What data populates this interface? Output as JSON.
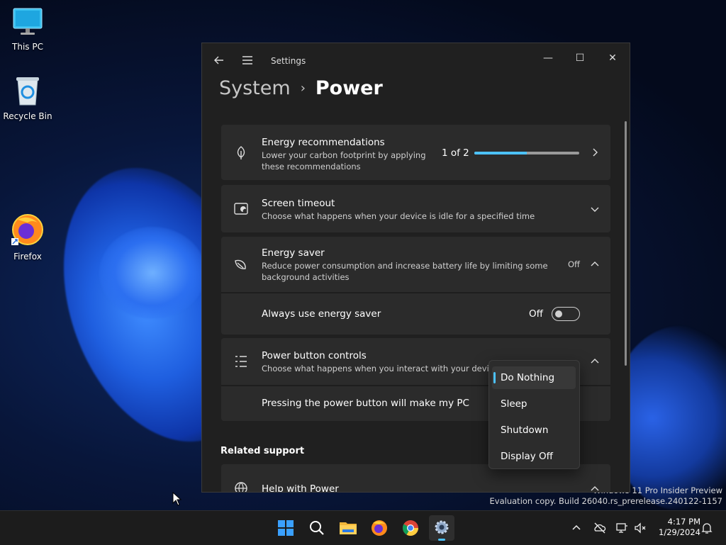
{
  "desktop": {
    "icons": [
      {
        "label": "This PC"
      },
      {
        "label": "Recycle Bin"
      },
      {
        "label": "Firefox"
      }
    ],
    "watermark": {
      "line1": "Windows 11 Pro Insider Preview",
      "line2": "Evaluation copy. Build 26040.rs_prerelease.240122-1157"
    }
  },
  "window": {
    "app_title": "Settings",
    "breadcrumb": {
      "parent": "System",
      "separator": "›",
      "current": "Power"
    },
    "controls": {
      "minimize": "—",
      "maximize": "☐",
      "close": "✕"
    },
    "energy_recommendations": {
      "title": "Energy recommendations",
      "desc_line1": "Lower your carbon footprint by applying",
      "desc_line2": "these recommendations",
      "progress_text": "1 of 2",
      "progress_fraction": 0.5
    },
    "screen_timeout": {
      "title": "Screen timeout",
      "desc": "Choose what happens when your device is idle for a specified time"
    },
    "energy_saver": {
      "title": "Energy saver",
      "desc_line1": "Reduce power consumption and increase battery life by limiting some",
      "desc_line2": "background activities",
      "status": "Off",
      "always_label": "Always use energy saver",
      "toggle_state": "Off"
    },
    "power_button_controls": {
      "title": "Power button controls",
      "desc": "Choose what happens when you interact with your device's",
      "row_label": "Pressing the power button will make my PC"
    },
    "related_support": {
      "heading": "Related support",
      "help_title": "Help with Power"
    }
  },
  "dropdown": {
    "options": [
      "Do Nothing",
      "Sleep",
      "Shutdown",
      "Display Off"
    ],
    "selected": "Do Nothing"
  },
  "taskbar": {
    "clock_time": "4:17 PM",
    "clock_date": "1/29/2024"
  },
  "colors": {
    "accent": "#4cc2ff",
    "card_bg": "#2b2b2b",
    "window_bg": "#202020"
  }
}
